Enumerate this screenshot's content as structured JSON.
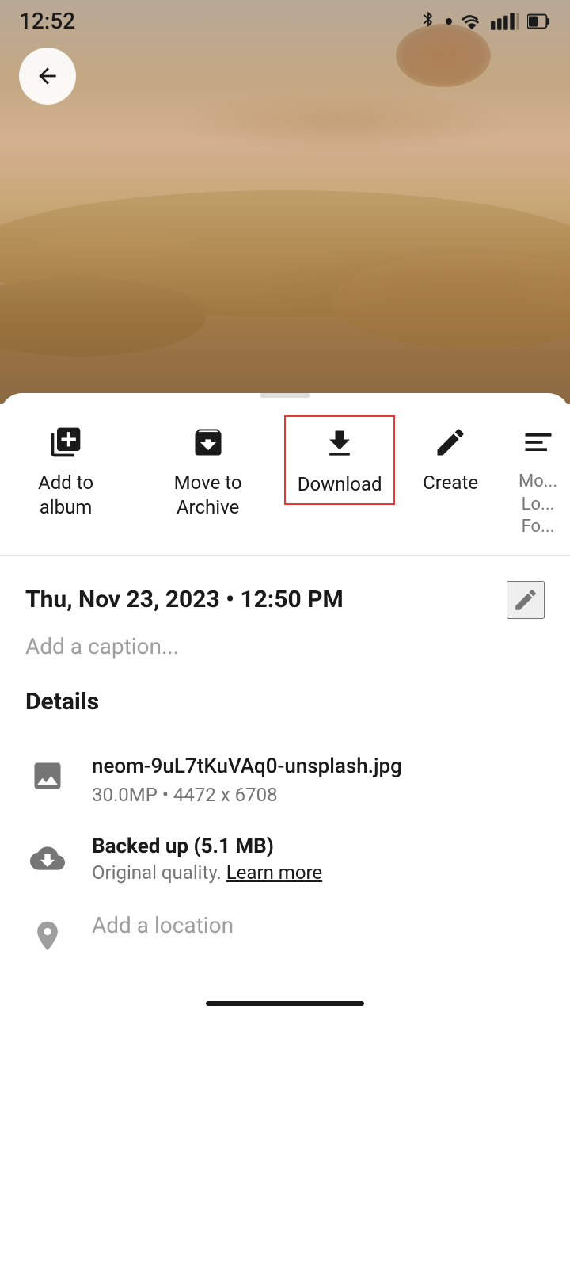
{
  "statusBar": {
    "time": "12:52"
  },
  "backButton": {
    "label": "back"
  },
  "actions": [
    {
      "id": "add-to-album",
      "icon": "add-to-album-icon",
      "label": "Add to\nalbum",
      "highlighted": false
    },
    {
      "id": "move-to-archive",
      "icon": "archive-icon",
      "label": "Move to\nArchive",
      "highlighted": false
    },
    {
      "id": "download",
      "icon": "download-icon",
      "label": "Download",
      "highlighted": true
    },
    {
      "id": "create",
      "icon": "create-icon",
      "label": "Create",
      "highlighted": false
    },
    {
      "id": "more",
      "icon": "more-icon",
      "label": "Mo...\nLo...\nFo...",
      "highlighted": false
    }
  ],
  "photoInfo": {
    "date": "Thu, Nov 23, 2023 • 12:50 PM",
    "captionPlaceholder": "Add a caption...",
    "detailsHeading": "Details"
  },
  "fileDetails": {
    "filename": "neom-9uL7tKuVAq0-unsplash.jpg",
    "resolution": "30.0MP  •  4472 x 6708",
    "backupTitle": "Backed up (5.1 MB)",
    "backupSub": "Original quality.",
    "learnMore": "Learn more",
    "locationPlaceholder": "Add a location"
  }
}
